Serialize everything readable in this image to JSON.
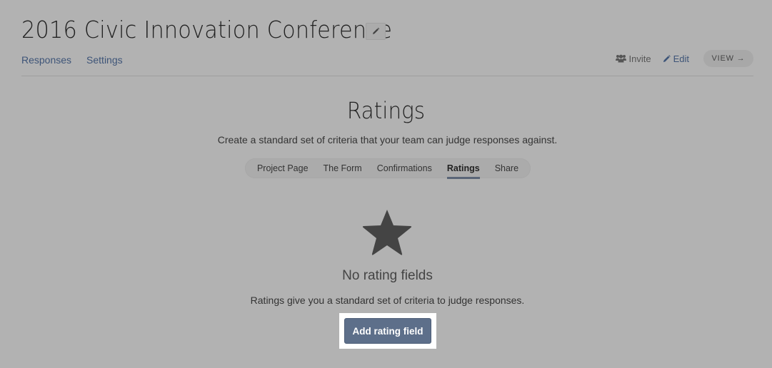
{
  "header": {
    "title": "2016 Civic Innovation Conference",
    "edit_title_icon": "pencil-icon",
    "nav_left": [
      {
        "label": "Responses"
      },
      {
        "label": "Settings"
      }
    ],
    "nav_right": {
      "invite_label": "Invite",
      "invite_icon": "users-icon",
      "edit_label": "Edit",
      "edit_icon": "pencil-icon",
      "view_label": "VIEW →"
    }
  },
  "section": {
    "title": "Ratings",
    "subtitle": "Create a standard set of criteria that your team can judge responses against.",
    "tabs": [
      {
        "label": "Project Page",
        "active": false
      },
      {
        "label": "The Form",
        "active": false
      },
      {
        "label": "Confirmations",
        "active": false
      },
      {
        "label": "Ratings",
        "active": true
      },
      {
        "label": "Share",
        "active": false
      }
    ]
  },
  "empty_state": {
    "icon": "star-icon",
    "title": "No rating fields",
    "description": "Ratings give you a standard set of criteria to judge responses.",
    "button_label": "Add rating field"
  },
  "colors": {
    "background": "#b2b2b2",
    "link": "#3d5478",
    "primary_button": "#5d6f8a",
    "star": "#444444"
  }
}
